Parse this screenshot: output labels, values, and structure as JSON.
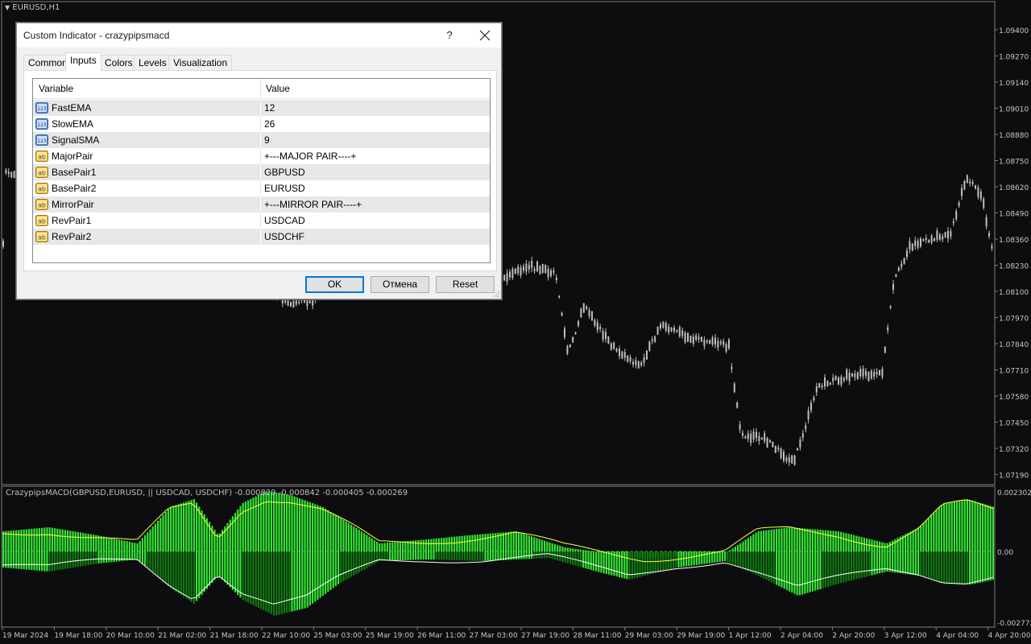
{
  "chart": {
    "symbol_label": "EURUSD,H1",
    "indicator_label": "CrazypipsMACD(GBPUSD,EURUSD, || USDCAD, USDCHF) -0.000829 -0.000842 -0.000405 -0.000269",
    "price_axis": [
      "1.09400",
      "1.09270",
      "1.09140",
      "1.09010",
      "1.08880",
      "1.08750",
      "1.08620",
      "1.08490",
      "1.08360",
      "1.08230",
      "1.08100",
      "1.07970",
      "1.07840",
      "1.07710",
      "1.07580",
      "1.07450",
      "1.07320",
      "1.07190"
    ],
    "indicator_axis": [
      "0.002302",
      "0.00",
      "-0.002772"
    ],
    "time_axis": [
      "19 Mar 2024",
      "19 Mar 18:00",
      "20 Mar 10:00",
      "21 Mar 02:00",
      "21 Mar 18:00",
      "22 Mar 10:00",
      "25 Mar 03:00",
      "25 Mar 19:00",
      "26 Mar 11:00",
      "27 Mar 03:00",
      "27 Mar 19:00",
      "28 Mar 11:00",
      "29 Mar 03:00",
      "29 Mar 19:00",
      "1 Apr 12:00",
      "2 Apr 04:00",
      "2 Apr 20:00",
      "3 Apr 12:00",
      "4 Apr 04:00",
      "4 Apr 20:00"
    ],
    "colors": {
      "background": "#0d0d10",
      "candle": "#c0c0c0",
      "histogram_bright": "#32e632",
      "histogram_dark": "#0f7a0f",
      "signal_yellow": "#ffff40",
      "signal_white": "#ffffff"
    }
  },
  "dialog": {
    "title": "Custom Indicator - crazypipsmacd",
    "help": "?",
    "tabs": [
      {
        "label": "Common",
        "active": false
      },
      {
        "label": "Inputs",
        "active": true
      },
      {
        "label": "Colors",
        "active": false
      },
      {
        "label": "Levels",
        "active": false
      },
      {
        "label": "Visualization",
        "active": false
      }
    ],
    "grid": {
      "col_variable": "Variable",
      "col_value": "Value",
      "rows": [
        {
          "icon": "number-type-icon",
          "name": "FastEMA",
          "value": "12"
        },
        {
          "icon": "number-type-icon",
          "name": "SlowEMA",
          "value": "26"
        },
        {
          "icon": "number-type-icon",
          "name": "SignalSMA",
          "value": "9"
        },
        {
          "icon": "string-type-icon",
          "name": "MajorPair",
          "value": "+---MAJOR PAIR----+"
        },
        {
          "icon": "string-type-icon",
          "name": "BasePair1",
          "value": "GBPUSD"
        },
        {
          "icon": "string-type-icon",
          "name": "BasePair2",
          "value": "EURUSD"
        },
        {
          "icon": "string-type-icon",
          "name": "MirrorPair",
          "value": "+---MIRROR PAIR----+"
        },
        {
          "icon": "string-type-icon",
          "name": "RevPair1",
          "value": "USDCAD"
        },
        {
          "icon": "string-type-icon",
          "name": "RevPair2",
          "value": "USDCHF"
        }
      ]
    },
    "buttons": {
      "ok": "OK",
      "cancel": "Отмена",
      "reset": "Reset"
    }
  }
}
